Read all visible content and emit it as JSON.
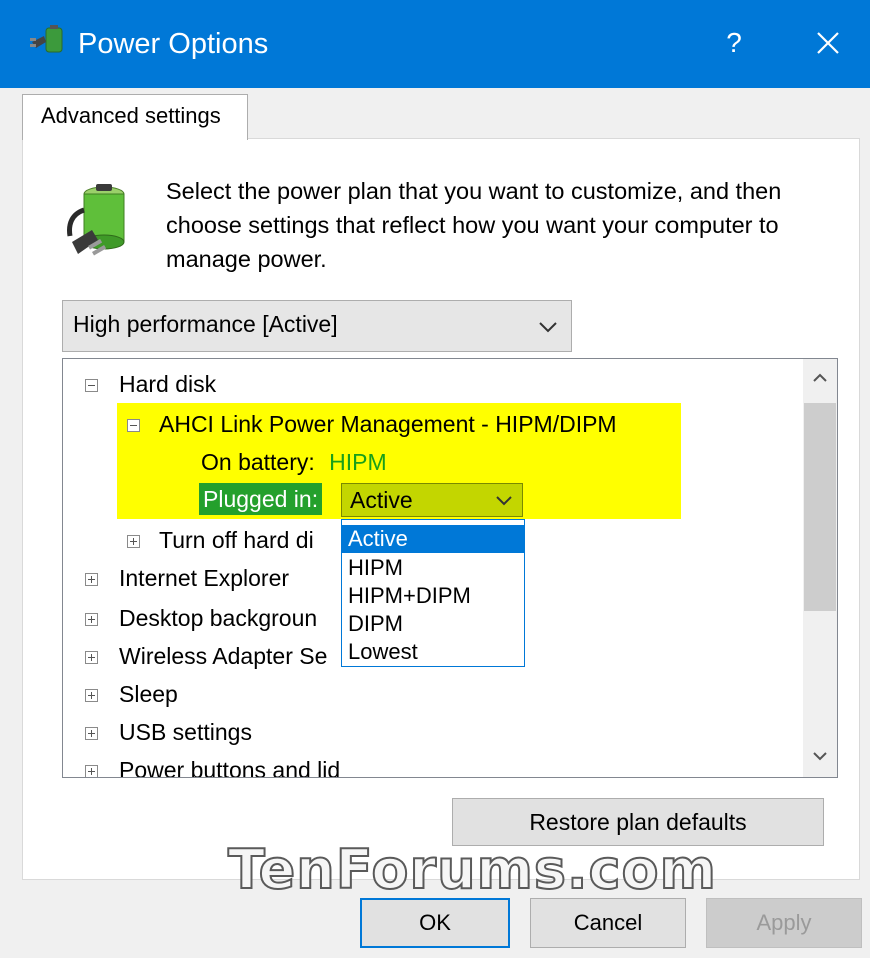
{
  "window": {
    "title": "Power Options",
    "help": "?"
  },
  "tab": {
    "label": "Advanced settings"
  },
  "description": "Select the power plan that you want to customize, and then choose settings that reflect how you want your computer to manage power.",
  "plan_select": {
    "value": "High performance [Active]"
  },
  "tree": {
    "hard_disk": "Hard disk",
    "ahci": "AHCI Link Power Management - HIPM/DIPM",
    "on_battery_label": "On battery:",
    "on_battery_value": "HIPM",
    "plugged_in_label": "Plugged in:",
    "plugged_in_value": "Active",
    "turn_off": "Turn off hard di",
    "internet_explorer": "Internet Explorer",
    "desktop_background": "Desktop backgroun",
    "wireless": "Wireless Adapter Se",
    "sleep": "Sleep",
    "usb": "USB settings",
    "power_buttons": "Power buttons and lid"
  },
  "dropdown_options": [
    "Active",
    "HIPM",
    "HIPM+DIPM",
    "DIPM",
    "Lowest"
  ],
  "buttons": {
    "restore": "Restore plan defaults",
    "ok": "OK",
    "cancel": "Cancel",
    "apply": "Apply"
  },
  "watermark": "TenForums.com",
  "colors": {
    "titlebar": "#0078d7",
    "highlight": "#ffff00",
    "plugged_label_bg": "#24a02c",
    "plugged_select_bg": "#c3d600",
    "on_battery_value": "#19a019"
  }
}
